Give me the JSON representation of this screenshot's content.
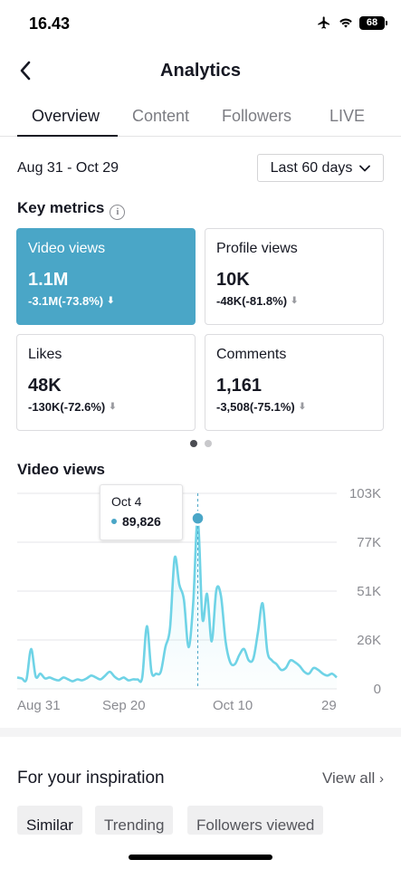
{
  "status": {
    "time": "16.43",
    "battery": "68"
  },
  "header": {
    "title": "Analytics"
  },
  "tabs": [
    {
      "label": "Overview",
      "active": true
    },
    {
      "label": "Content",
      "active": false
    },
    {
      "label": "Followers",
      "active": false
    },
    {
      "label": "LIVE",
      "active": false
    }
  ],
  "filter": {
    "date_range": "Aug 31 - Oct 29",
    "period": "Last 60 days"
  },
  "key_metrics": {
    "title": "Key metrics",
    "cards": [
      {
        "label": "Video views",
        "value": "1.1M",
        "change": "-3.1M(-73.8%)",
        "selected": true
      },
      {
        "label": "Profile views",
        "value": "10K",
        "change": "-48K(-81.8%)",
        "selected": false
      },
      {
        "label": "Likes",
        "value": "48K",
        "change": "-130K(-72.6%)",
        "selected": false
      },
      {
        "label": "Comments",
        "value": "1,161",
        "change": "-3,508(-75.1%)",
        "selected": false
      }
    ]
  },
  "chart_section": {
    "title": "Video views"
  },
  "tooltip": {
    "date": "Oct 4",
    "value": "89,826"
  },
  "chart_data": {
    "type": "area",
    "title": "Video views",
    "x_tick_labels": [
      "Aug 31",
      "Sep 20",
      "Oct 10",
      "29"
    ],
    "y_tick_labels": [
      "103K",
      "77K",
      "51K",
      "26K",
      "0"
    ],
    "ylim": [
      0,
      103000
    ],
    "grid": true,
    "color": "#6fd3e6",
    "series": [
      {
        "values": [
          6000,
          5500,
          5000,
          21000,
          6500,
          8000,
          5500,
          6000,
          5000,
          4500,
          6000,
          5000,
          4000,
          5000,
          4500,
          5500,
          7000,
          6000,
          5000,
          7000,
          9000,
          6500,
          5000,
          6000,
          4500,
          5000,
          5000,
          6000,
          33000,
          9000,
          8000,
          9000,
          22000,
          32000,
          69000,
          55000,
          47000,
          22000,
          45000,
          89826,
          37000,
          50000,
          25000,
          52000,
          49000,
          25000,
          14000,
          13000,
          18000,
          21000,
          15000,
          16000,
          30000,
          45000,
          20000,
          15000,
          13000,
          10000,
          11000,
          15000,
          14000,
          12000,
          9000,
          8000,
          11000,
          10000,
          8000,
          7000,
          8000,
          6000
        ]
      }
    ],
    "highlight": {
      "x": "Oct 4",
      "y": 89826
    }
  },
  "inspiration": {
    "title": "For your inspiration",
    "view_all": "View all",
    "chips": [
      "Similar",
      "Trending",
      "Followers viewed"
    ]
  },
  "colors": {
    "accent": "#4aa6c7",
    "line": "#6fd3e6"
  }
}
